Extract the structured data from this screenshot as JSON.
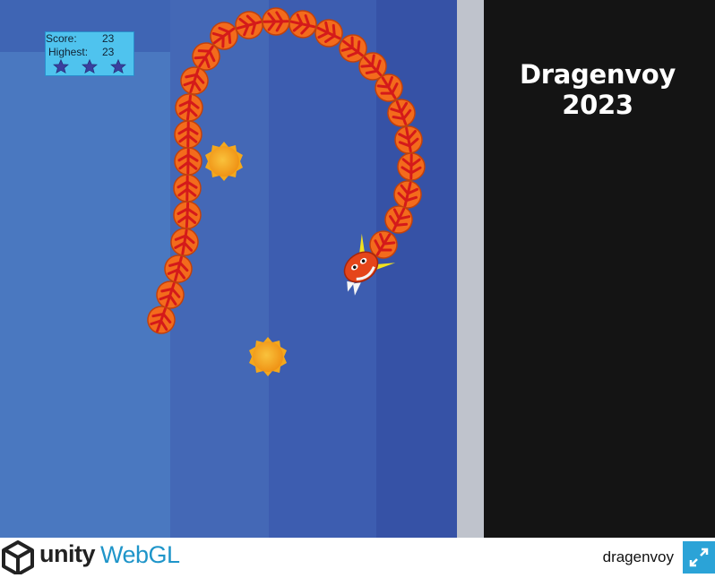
{
  "hud": {
    "score_label": "Score:",
    "score_value": "23",
    "highest_label": "Highest:",
    "highest_value": "23",
    "stars_total": 3
  },
  "panel": {
    "title": "Dragenvoy 2023"
  },
  "footer": {
    "unity_label": "unity",
    "webgl_label": "WebGL",
    "game_name": "dragenvoy",
    "fullscreen_icon": "fullscreen-expand-icon"
  },
  "game_objects": {
    "dragon_head_icon": "dragon-head-icon",
    "dragon_body_segment_icon": "dragon-segment-icon",
    "sun_orb_icon": "sun-orb-icon",
    "orb_count": 2
  },
  "colors": {
    "game_background": "#3f5fae",
    "panel_background": "#141414",
    "hud_background": "#4fc3ee",
    "webgl_blue": "#1f95c9",
    "fullscreen_button": "#2ba3d7",
    "segment_orange": "#f36b1c",
    "segment_red": "#d41a1a",
    "orb_yellow": "#f4a81c"
  }
}
